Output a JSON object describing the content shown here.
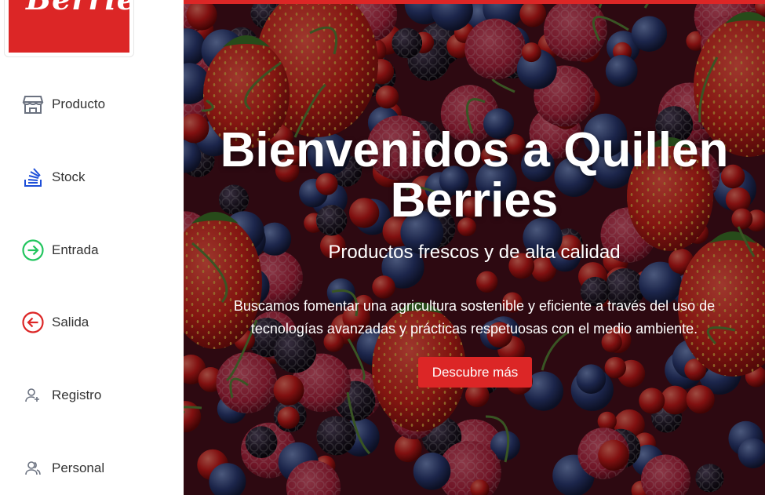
{
  "logo": {
    "text": "Berries"
  },
  "nav": {
    "items": [
      {
        "label": "Producto",
        "icon": "store-icon",
        "color": "#6b7280"
      },
      {
        "label": "Stock",
        "icon": "stack-icon",
        "color": "#1d4ed8"
      },
      {
        "label": "Entrada",
        "icon": "arrow-right-circle-icon",
        "color": "#22c55e"
      },
      {
        "label": "Salida",
        "icon": "arrow-left-circle-icon",
        "color": "#dc2626"
      },
      {
        "label": "Registro",
        "icon": "user-add-icon",
        "color": "#6b7280"
      },
      {
        "label": "Personal",
        "icon": "users-icon",
        "color": "#6b7280"
      }
    ]
  },
  "hero": {
    "title": "Bienvenidos a Quillen Berries",
    "subtitle": "Productos frescos y de alta calidad",
    "description": "Buscamos fomentar una agricultura sostenible y eficiente a través del uso de tecnologías avanzadas y prácticas respetuosas con el medio ambiente.",
    "button_label": "Descubre más",
    "accent_color": "#dc2626"
  }
}
